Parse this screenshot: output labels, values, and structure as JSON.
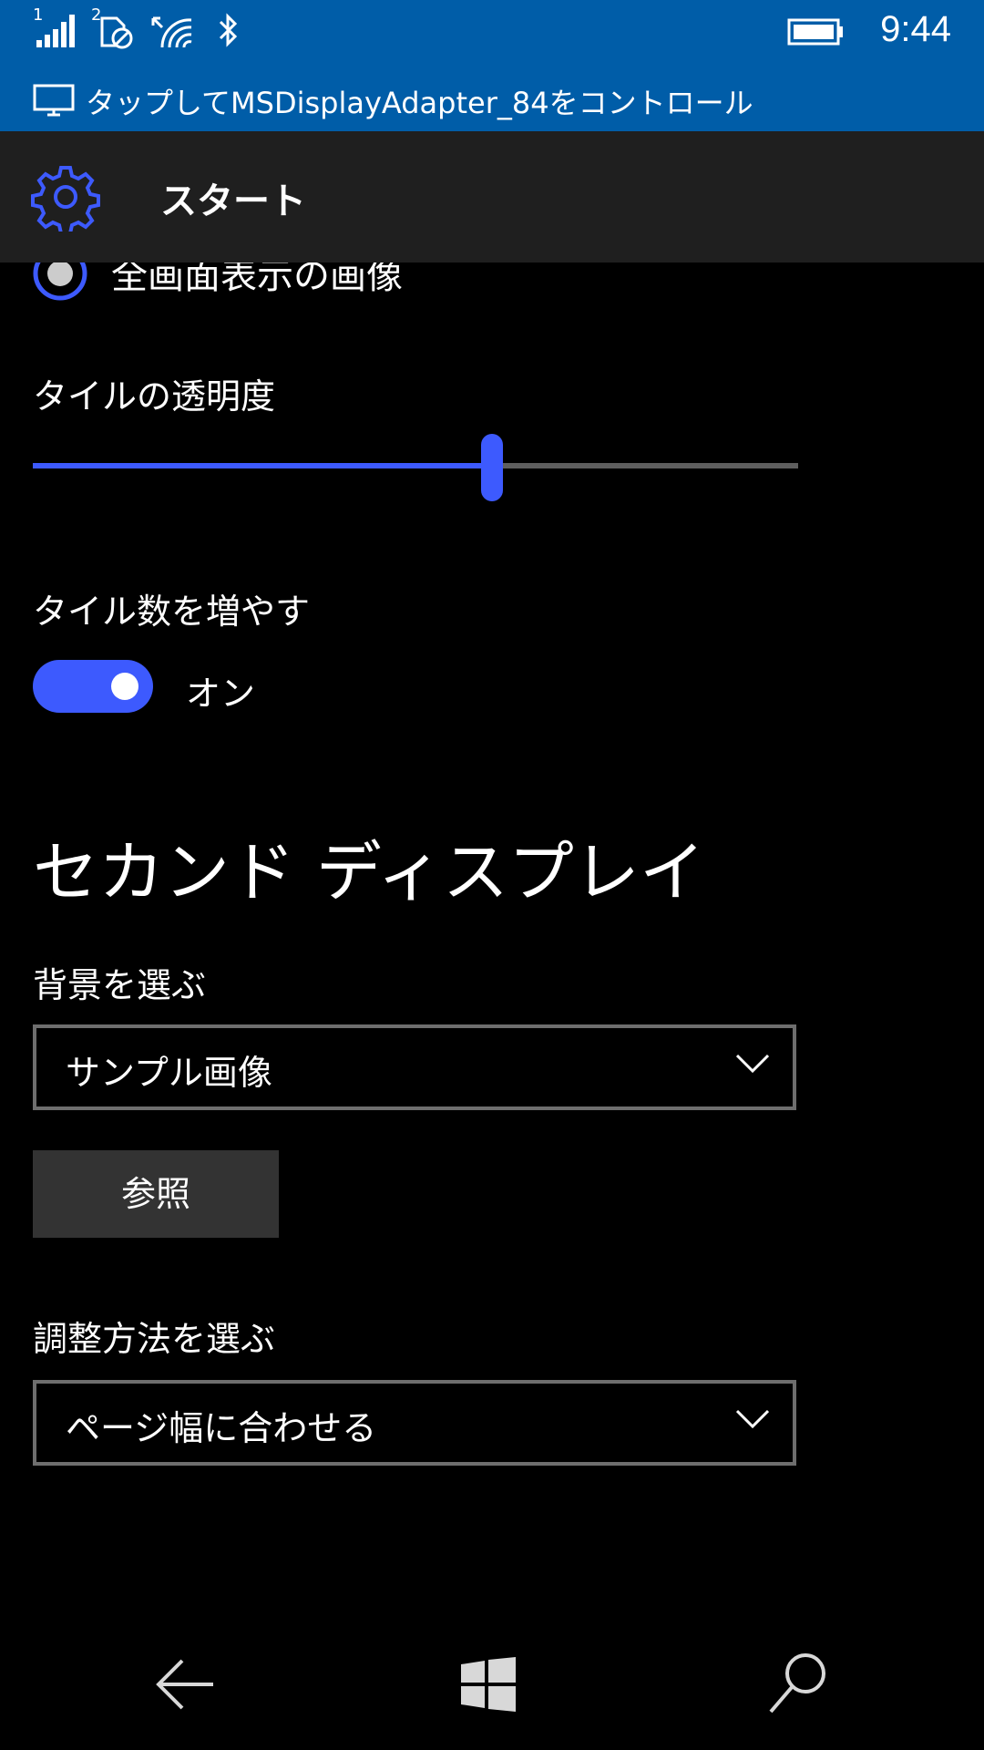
{
  "status_bar": {
    "sim1_label": "1",
    "sim2_label": "2",
    "time": "9:44"
  },
  "notification": {
    "text": "タップしてMSDisplayAdapter_84をコントロール"
  },
  "header": {
    "title": "スタート"
  },
  "settings": {
    "fullscreen_option_label": "全画面表示の画像",
    "transparency_label": "タイルの透明度",
    "transparency_value": 0.6,
    "more_tiles_label": "タイル数を増やす",
    "more_tiles_state": "オン"
  },
  "second_display": {
    "title": "セカンド ディスプレイ",
    "background_label": "背景を選ぶ",
    "background_value": "サンプル画像",
    "browse_button": "参照",
    "fit_label": "調整方法を選ぶ",
    "fit_value": "ページ幅に合わせる"
  },
  "colors": {
    "accent": "#3d5afe",
    "status_bar": "#005da8",
    "header_bg": "#1f1f1f"
  },
  "icons": [
    "signal-icon",
    "sim-icon",
    "wifi-icon",
    "bluetooth-icon",
    "battery-icon",
    "monitor-icon",
    "gear-icon",
    "back-icon",
    "windows-icon",
    "search-icon",
    "chevron-down-icon"
  ]
}
